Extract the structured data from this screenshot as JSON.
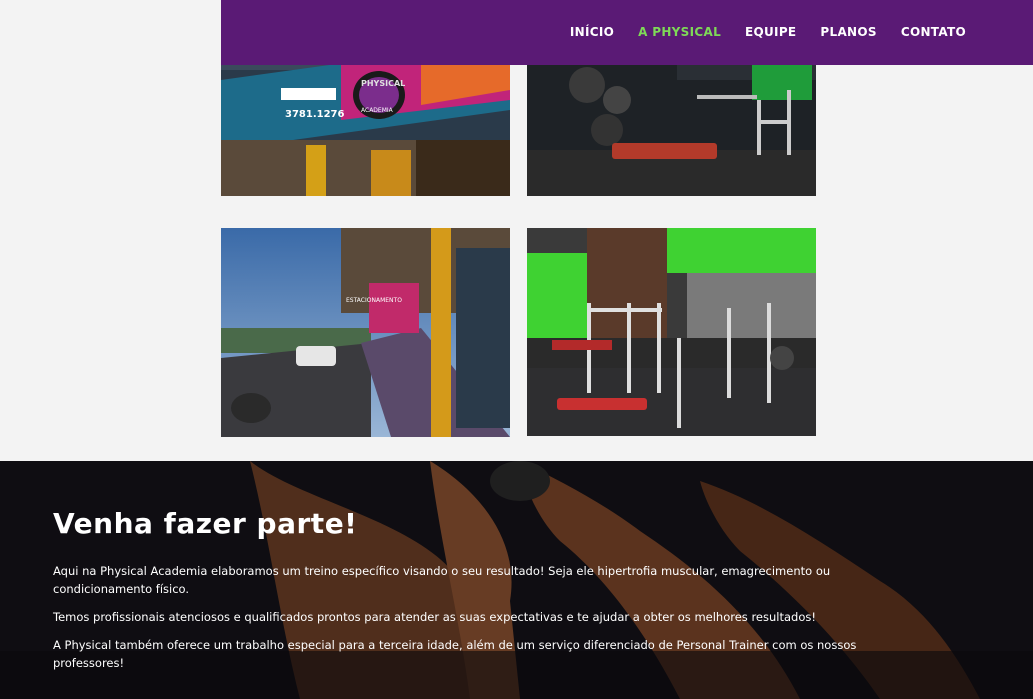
{
  "nav": {
    "items": [
      {
        "label": "INÍCIO",
        "active": false
      },
      {
        "label": "A PHYSICAL",
        "active": true
      },
      {
        "label": "EQUIPE",
        "active": false
      },
      {
        "label": "PLANOS",
        "active": false
      },
      {
        "label": "CONTATO",
        "active": false
      }
    ]
  },
  "gallery": {
    "photos": [
      {
        "name": "storefront-sign-photo",
        "sign_phone": "3781.1276",
        "sign_brand": "PHYSICAL",
        "sign_sub": "ACADEMIA"
      },
      {
        "name": "gym-weights-photo"
      },
      {
        "name": "street-view-photo",
        "sign_text": "ESTACIONAMENTO"
      },
      {
        "name": "gym-equipment-photo"
      }
    ]
  },
  "hero": {
    "title": "Venha fazer parte!",
    "paragraphs": [
      "Aqui na Physical Academia elaboramos um treino específico visando o seu resultado! Seja ele hipertrofia muscular, emagrecimento ou condicionamento físico.",
      "Temos profissionais atenciosos e qualificados prontos para atender as suas expectativas e te ajudar a obter os melhores resultados!",
      "A Physical também oferece um trabalho especial para a terceira idade, além de um serviço diferenciado de Personal Trainer com os nossos professores!"
    ]
  },
  "colors": {
    "header_bg": "#5a1a75",
    "nav_active": "#7ed957",
    "hero_bg": "#121016"
  }
}
